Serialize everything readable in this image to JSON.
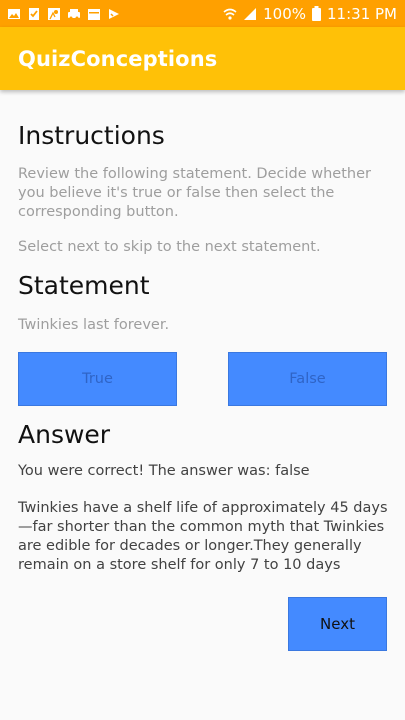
{
  "status_bar": {
    "battery": "100%",
    "time": "11:31 PM",
    "left_icons": [
      "image-icon",
      "clipboard-check-icon",
      "map-pin-icon",
      "car-icon",
      "calendar-icon",
      "check-icon"
    ],
    "right_icons": [
      "wifi-icon",
      "signal-icon",
      "battery-icon"
    ],
    "background": "#ffa000"
  },
  "app_bar": {
    "title": "QuizConceptions",
    "background": "#ffc107"
  },
  "instructions": {
    "heading": "Instructions",
    "text": "Review the following statement. Decide whether you believe it's true or false then select the corresponding button.",
    "skip_text": "Select next to skip to the next statement."
  },
  "statement": {
    "heading": "Statement",
    "text": "Twinkies last forever."
  },
  "buttons": {
    "true_label": "True",
    "false_label": "False",
    "next_label": "Next",
    "color": "#448aff"
  },
  "answer": {
    "heading": "Answer",
    "result": "You were correct! The answer was: false",
    "explanation": "Twinkies have a shelf life of approximately 45 days —far shorter than the common myth that Twinkies are edible for decades or longer.They generally remain on a store shelf for only 7 to 10 days"
  }
}
